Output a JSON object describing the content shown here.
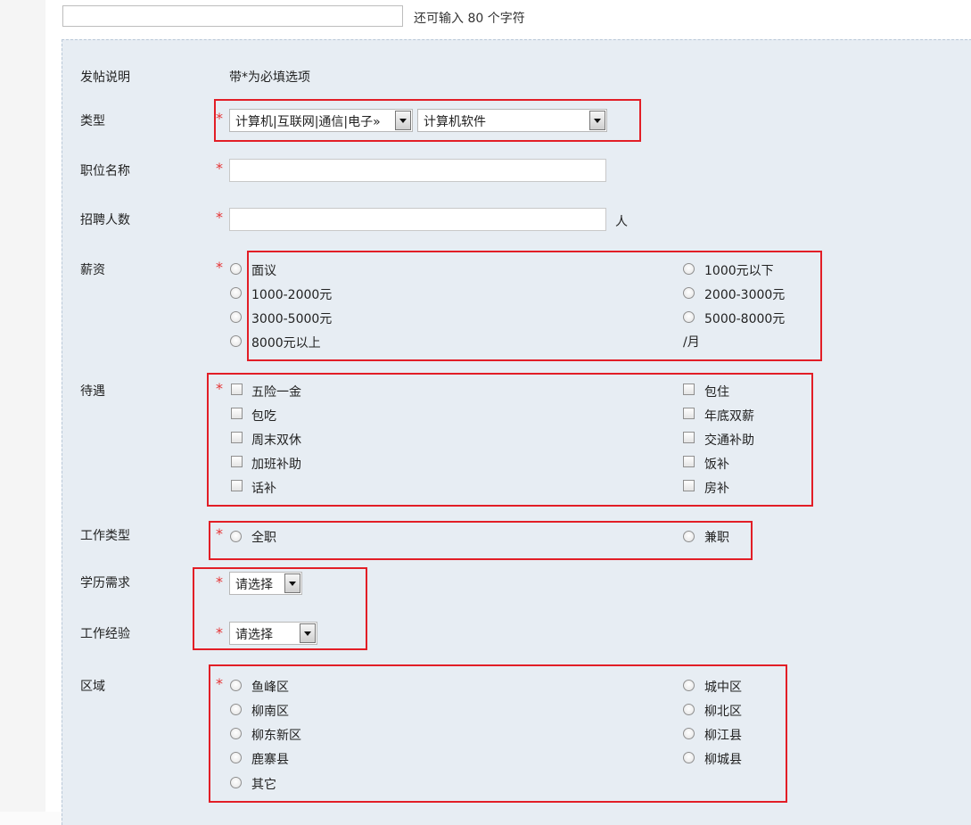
{
  "header": {
    "title_value": "",
    "remain_text": "还可输入 80 个字符"
  },
  "form": {
    "note_label": "发帖说明",
    "note_text": "带*为必填选项",
    "required_mark": "*",
    "category": {
      "label": "类型",
      "primary_value": "计算机|互联网|通信|电子»",
      "secondary_value": "计算机软件"
    },
    "position": {
      "label": "职位名称",
      "value": ""
    },
    "headcount": {
      "label": "招聘人数",
      "value": "",
      "unit": "人"
    },
    "salary": {
      "label": "薪资",
      "left_options": [
        "面议",
        "1000-2000元",
        "3000-5000元",
        "8000元以上"
      ],
      "right_options": [
        "1000元以下",
        "2000-3000元",
        "5000-8000元"
      ],
      "suffix": "/月"
    },
    "benefits": {
      "label": "待遇",
      "left_options": [
        "五险一金",
        "包吃",
        "周末双休",
        "加班补助",
        "话补"
      ],
      "right_options": [
        "包住",
        "年底双薪",
        "交通补助",
        "饭补",
        "房补"
      ]
    },
    "job_type": {
      "label": "工作类型",
      "left_options": [
        "全职"
      ],
      "right_options": [
        "兼职"
      ]
    },
    "education": {
      "label": "学历需求",
      "value": "请选择"
    },
    "experience": {
      "label": "工作经验",
      "value": "请选择"
    },
    "district": {
      "label": "区域",
      "left_options": [
        "鱼峰区",
        "柳南区",
        "柳东新区",
        "鹿寨县",
        "其它"
      ],
      "right_options": [
        "城中区",
        "柳北区",
        "柳江县",
        "柳城县"
      ]
    }
  },
  "colors": {
    "highlight": "#e21e26",
    "required": "#e53333",
    "panel_bg": "#e7edf3"
  }
}
